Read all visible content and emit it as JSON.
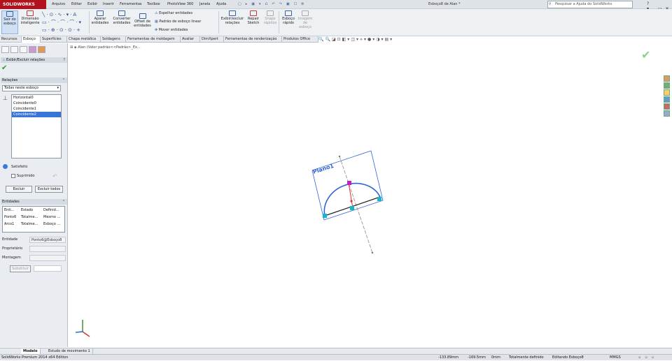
{
  "app": {
    "logo": "SOLIDWORKS",
    "document_title": "Esboço8 de Alan *"
  },
  "menu": [
    "Arquivo",
    "Editar",
    "Exibir",
    "Inserir",
    "Ferramentas",
    "Toolbox",
    "PhotoView 360",
    "Janela",
    "Ajuda"
  ],
  "search": {
    "placeholder": "Pesquisar a Ajuda do SolidWorks"
  },
  "ribbon": {
    "exit_sketch": "Sair do esboço",
    "smart_dimension": "Dimensão inteligente",
    "trim": "Aparar entidades",
    "convert": "Converter entidades",
    "offset": "Offset de entidades",
    "mirror": "Espelhar entidades",
    "pattern": "Padrão de esboço linear",
    "move": "Mover entidades",
    "relations": "Exibir/excluir relações",
    "repair": "Repair Sketch",
    "snaps": "Snaps rápidos",
    "rapid": "Esboço rápido",
    "image": "Imagem de esboço"
  },
  "tabs": [
    "Recursos",
    "Esboço",
    "Superfícies",
    "Chapa metálica",
    "Soldagens",
    "Ferramentas de moldagem",
    "Avaliar",
    "DimXpert",
    "Ferramentas de renderização",
    "Produtos Office"
  ],
  "active_tab": "Esboço",
  "panel": {
    "title": "Exibir/Excluir relações",
    "relations_header": "Relações",
    "filter": "Todas neste esboço",
    "relations": [
      "Horizontal0",
      "Coincidente0",
      "Coincidente1",
      "Coincidente2"
    ],
    "selected_relation": "Coincidente2",
    "status": "Satisfeito",
    "suppressed": "Suprimido",
    "delete": "Excluir",
    "delete_all": "Excluir todos",
    "entities_header": "Entidades",
    "entities_columns": [
      "Enti...",
      "Estado",
      "Definid..."
    ],
    "entities_rows": [
      [
        "Ponto6",
        "Totalme...",
        "Mesmo ..."
      ],
      [
        "Arco1",
        "Totalme...",
        "Esboço ..."
      ]
    ],
    "entity_label": "Entidade",
    "entity_value": "Ponto6@Esboço8",
    "owner_label": "Proprietário",
    "assembly_label": "Montagem",
    "replace": "Substituir"
  },
  "tree": {
    "root": "Alan (Valor padrão<<Padrão>_Ex..."
  },
  "sketch": {
    "plane_label": "Plano1"
  },
  "bottom_tabs": [
    "Modelo",
    "Estudo de movimento 1"
  ],
  "status": {
    "edition": "SolidWorks Premium 2014 x64 Edition",
    "x": "-133.89mm",
    "y": "-169.5mm",
    "z": "0mm",
    "defined": "Totalmente definido",
    "editing": "Editando Esboço8",
    "units": "MMGS"
  },
  "colors": {
    "brand": "#b1121b",
    "selection": "#3875d7",
    "sketch_blue": "#2e63d6",
    "relation_cyan": "#12b7c9",
    "point_magenta": "#c022c0"
  }
}
